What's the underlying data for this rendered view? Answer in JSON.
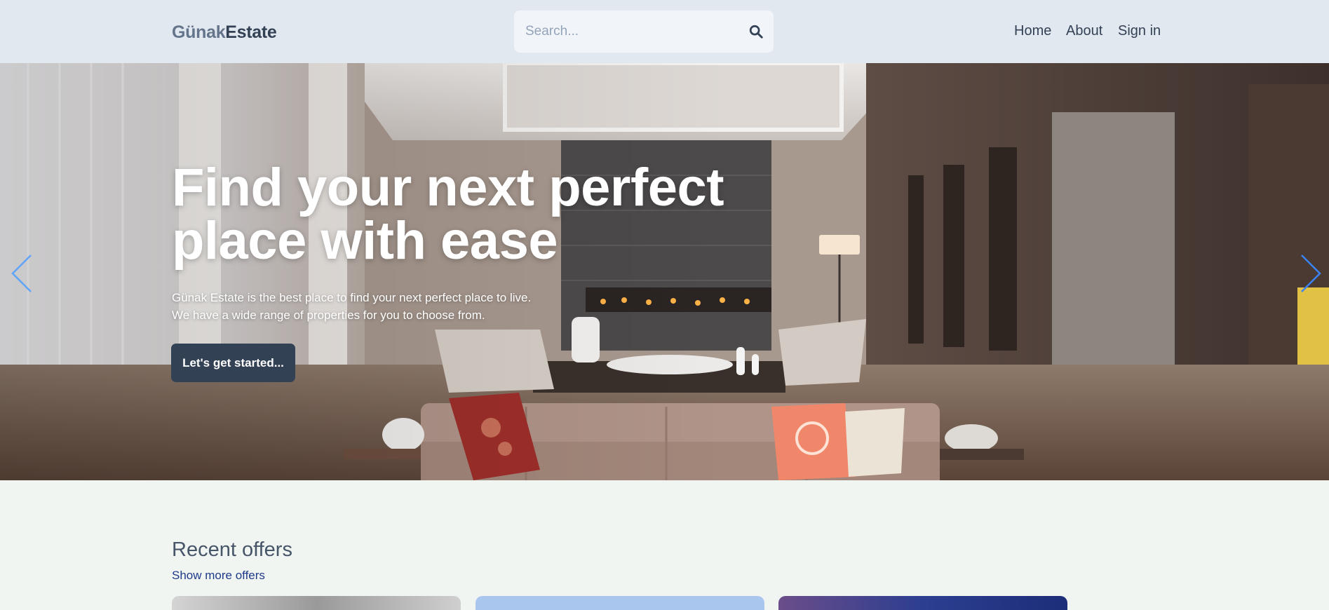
{
  "header": {
    "logo_part1": "Günak",
    "logo_part2": "Estate",
    "search": {
      "placeholder": "Search..."
    },
    "nav": [
      "Home",
      "About",
      "Sign in"
    ]
  },
  "hero": {
    "title_line1": "Find your next perfect",
    "title_line2": "place with ease",
    "subtitle_line1": "Günak Estate is the best place to find your next perfect place to live.",
    "subtitle_line2": "We have a wide range of properties for you to choose from.",
    "cta_label": "Let's get started..."
  },
  "recent": {
    "title": "Recent offers",
    "link": "Show more offers"
  },
  "icons": {
    "search": "search-icon",
    "prev": "chevron-left-icon",
    "next": "chevron-right-icon"
  },
  "colors": {
    "header_bg": "#e2e8f0",
    "primary": "#334155",
    "link": "#1e3a8a",
    "arrow": "#3b82f6",
    "page_bg": "#f1f5f2"
  }
}
